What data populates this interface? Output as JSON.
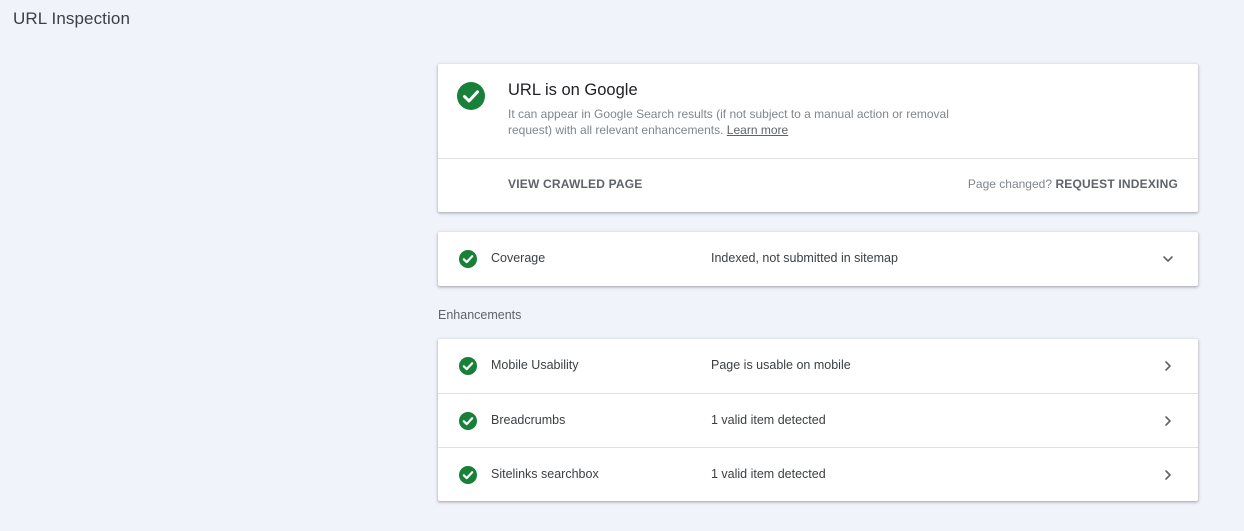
{
  "header": {
    "title": "URL Inspection"
  },
  "status": {
    "icon": "check-circle-icon",
    "title": "URL is on Google",
    "description": "It can appear in Google Search results (if not subject to a manual action or removal request) with all relevant enhancements.",
    "learn_more": "Learn more",
    "view_crawled_label": "VIEW CRAWLED PAGE",
    "page_changed_text": "Page changed?",
    "request_indexing_label": "REQUEST INDEXING"
  },
  "coverage": {
    "label": "Coverage",
    "value": "Indexed, not submitted in sitemap",
    "icon": "check-circle-icon",
    "chevron": "chevron-down-icon"
  },
  "enhancements": {
    "section_label": "Enhancements",
    "items": [
      {
        "label": "Mobile Usability",
        "value": "Page is usable on mobile",
        "icon": "check-circle-icon",
        "chevron": "chevron-right-icon"
      },
      {
        "label": "Breadcrumbs",
        "value": "1 valid item detected",
        "icon": "check-circle-icon",
        "chevron": "chevron-right-icon"
      },
      {
        "label": "Sitelinks searchbox",
        "value": "1 valid item detected",
        "icon": "check-circle-icon",
        "chevron": "chevron-right-icon"
      }
    ]
  },
  "colors": {
    "success_green": "#188038",
    "background": "#f1f3fb",
    "card": "#ffffff",
    "text_primary": "#202124",
    "text_secondary": "#80868b"
  }
}
